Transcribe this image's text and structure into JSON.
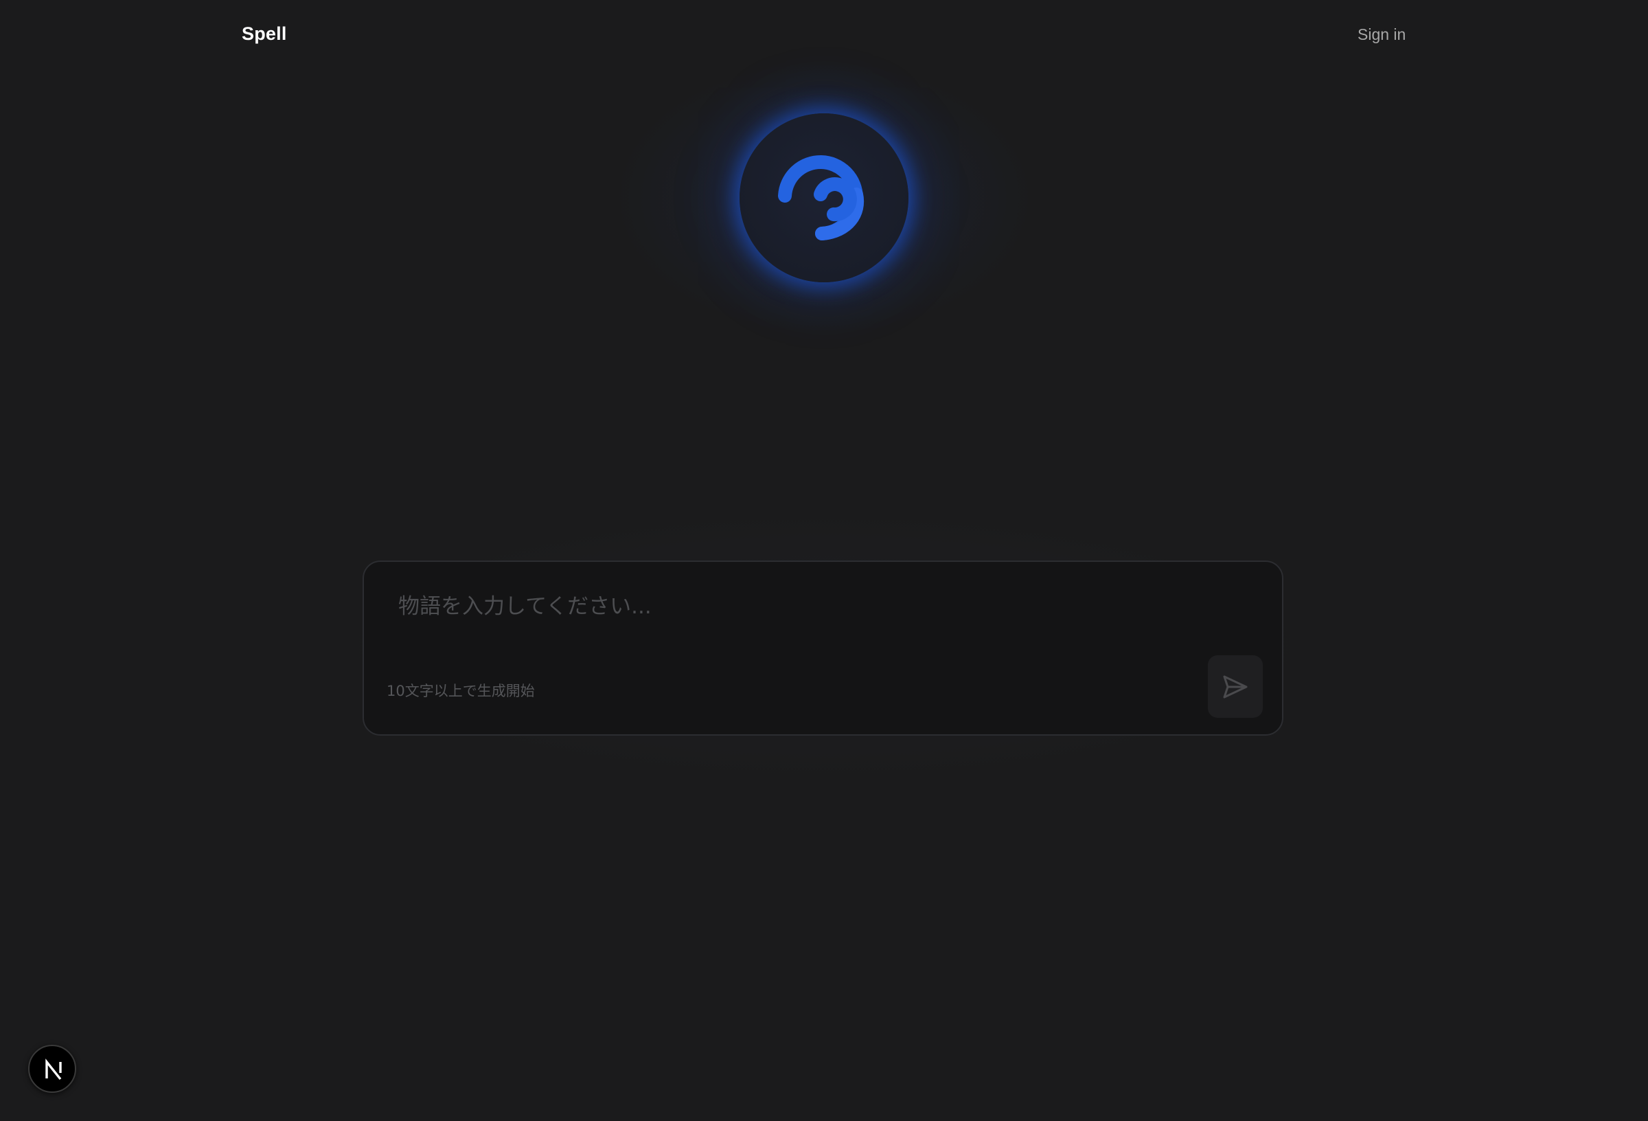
{
  "header": {
    "brand": "Spell",
    "sign_in_label": "Sign in"
  },
  "composer": {
    "placeholder": "物語を入力してください...",
    "value": "",
    "hint": "10文字以上で生成開始"
  },
  "icons": {
    "hero": "spinner-swirl-icon",
    "send": "send-icon",
    "framework_badge": "nextjs-n-icon"
  },
  "colors": {
    "background": "#1b1b1c",
    "accent": "#2463e0",
    "composer_bg": "#141415"
  }
}
